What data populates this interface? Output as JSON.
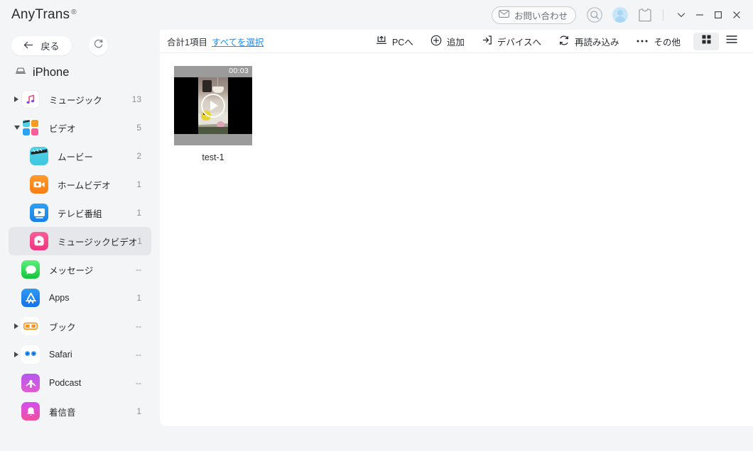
{
  "window": {
    "brand": "AnyTrans",
    "brand_mark": "®",
    "contact_label": "お問い合わせ",
    "icons": {
      "mail": "mail-icon",
      "search": "search-icon",
      "avatar": "user-avatar",
      "shirt": "shirt-icon",
      "chevron_down": "chevron-down-icon",
      "minimize": "minimize-icon",
      "maximize": "maximize-icon",
      "close": "close-icon"
    }
  },
  "sidebar": {
    "back_label": "戻る",
    "refresh_label": "",
    "device": "iPhone",
    "items": [
      {
        "label": "ミュージック",
        "count": "13",
        "arrow": "collapsed",
        "icon": "music-icon",
        "icon_class": "ic-music",
        "level": "top",
        "selected": false
      },
      {
        "label": "ビデオ",
        "count": "5",
        "arrow": "expanded",
        "icon": "video-icon",
        "icon_class": "ic-video",
        "level": "top",
        "selected": false
      },
      {
        "label": "ムービー",
        "count": "2",
        "arrow": "none",
        "icon": "movie-icon",
        "icon_class": "ic-movie",
        "level": "sub",
        "selected": false
      },
      {
        "label": "ホームビデオ",
        "count": "1",
        "arrow": "none",
        "icon": "home-video-icon",
        "icon_class": "ic-home",
        "level": "sub",
        "selected": false
      },
      {
        "label": "テレビ番組",
        "count": "1",
        "arrow": "none",
        "icon": "tv-show-icon",
        "icon_class": "ic-tv",
        "level": "sub",
        "selected": false
      },
      {
        "label": "ミュージックビデオ",
        "count": "1",
        "arrow": "none",
        "icon": "music-video-icon",
        "icon_class": "ic-mv",
        "level": "sub",
        "selected": true
      },
      {
        "label": "メッセージ",
        "count": "--",
        "arrow": "none",
        "icon": "messages-icon",
        "icon_class": "ic-msg",
        "level": "top",
        "selected": false
      },
      {
        "label": "Apps",
        "count": "1",
        "arrow": "none",
        "icon": "app-store-icon",
        "icon_class": "ic-apps",
        "level": "top",
        "selected": false
      },
      {
        "label": "ブック",
        "count": "--",
        "arrow": "collapsed",
        "icon": "books-icon",
        "icon_class": "ic-book",
        "level": "top",
        "selected": false
      },
      {
        "label": "Safari",
        "count": "--",
        "arrow": "collapsed",
        "icon": "safari-icon",
        "icon_class": "ic-safari",
        "level": "top",
        "selected": false
      },
      {
        "label": "Podcast",
        "count": "--",
        "arrow": "none",
        "icon": "podcast-icon",
        "icon_class": "ic-podcast",
        "level": "top",
        "selected": false
      },
      {
        "label": "着信音",
        "count": "1",
        "arrow": "none",
        "icon": "ringtone-icon",
        "icon_class": "ic-ring",
        "level": "top",
        "selected": false
      }
    ]
  },
  "toolbar": {
    "count_text": "合計1項目",
    "select_all_label": "すべてを選択",
    "actions": [
      {
        "label": "PCへ",
        "icon": "export-to-pc-icon"
      },
      {
        "label": "追加",
        "icon": "add-icon"
      },
      {
        "label": "デバイスへ",
        "icon": "send-to-device-icon"
      },
      {
        "label": "再読み込み",
        "icon": "reload-icon"
      },
      {
        "label": "その他",
        "icon": "more-icon"
      }
    ],
    "view_grid": "grid-view-icon",
    "view_list": "list-view-icon",
    "active_view": "grid"
  },
  "content": {
    "items": [
      {
        "name": "test-1",
        "duration": "00:03"
      }
    ]
  },
  "colors": {
    "accent_link": "#1a8cff",
    "sidebar_bg": "#f4f5f7",
    "panel_bg": "#ffffff",
    "selected_row": "#e6e7ea"
  }
}
